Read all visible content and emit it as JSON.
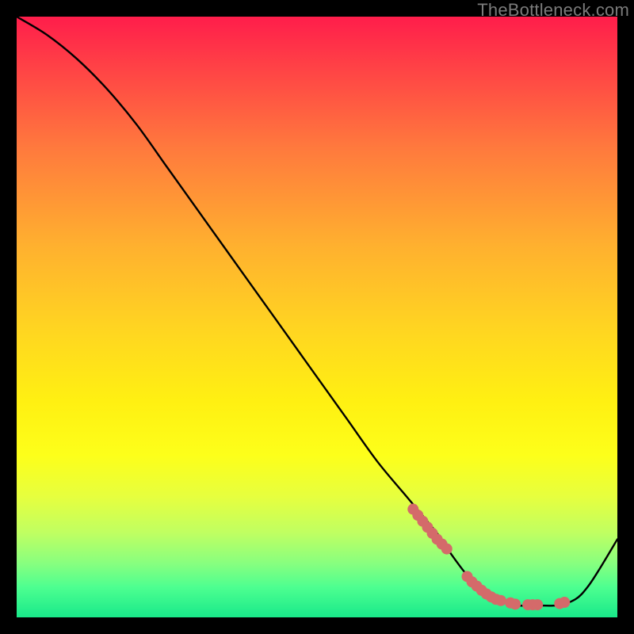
{
  "watermark": "TheBottleneck.com",
  "chart_data": {
    "type": "line",
    "title": "",
    "xlabel": "",
    "ylabel": "",
    "xlim": [
      0,
      100
    ],
    "ylim": [
      0,
      100
    ],
    "grid": false,
    "legend": false,
    "series": [
      {
        "name": "curve",
        "color": "#000000",
        "x": [
          0,
          5,
          10,
          15,
          20,
          25,
          30,
          35,
          40,
          45,
          50,
          55,
          60,
          65,
          70,
          72,
          75,
          78,
          80,
          83,
          86,
          90,
          93,
          95,
          97,
          100
        ],
        "y": [
          100,
          97,
          93,
          88,
          82,
          75,
          68,
          61,
          54,
          47,
          40,
          33,
          26,
          20,
          14,
          11,
          7,
          4,
          3,
          2,
          2,
          2,
          3,
          5,
          8,
          13
        ]
      }
    ],
    "markers": [
      {
        "name": "dots",
        "color": "#d46a6a",
        "radius_px": 7,
        "x": [
          66.0,
          66.8,
          67.6,
          68.4,
          69.2,
          70.0,
          70.8,
          71.6,
          75.0,
          75.8,
          76.6,
          77.4,
          78.2,
          79.0,
          79.8,
          80.6,
          82.2,
          83.0,
          85.1,
          85.9,
          86.7,
          90.4,
          91.2
        ],
        "y": [
          18.0,
          17.0,
          16.0,
          15.0,
          14.0,
          13.0,
          12.2,
          11.4,
          6.8,
          5.9,
          5.2,
          4.5,
          3.9,
          3.4,
          3.0,
          2.8,
          2.4,
          2.2,
          2.1,
          2.1,
          2.1,
          2.3,
          2.5
        ]
      }
    ]
  }
}
